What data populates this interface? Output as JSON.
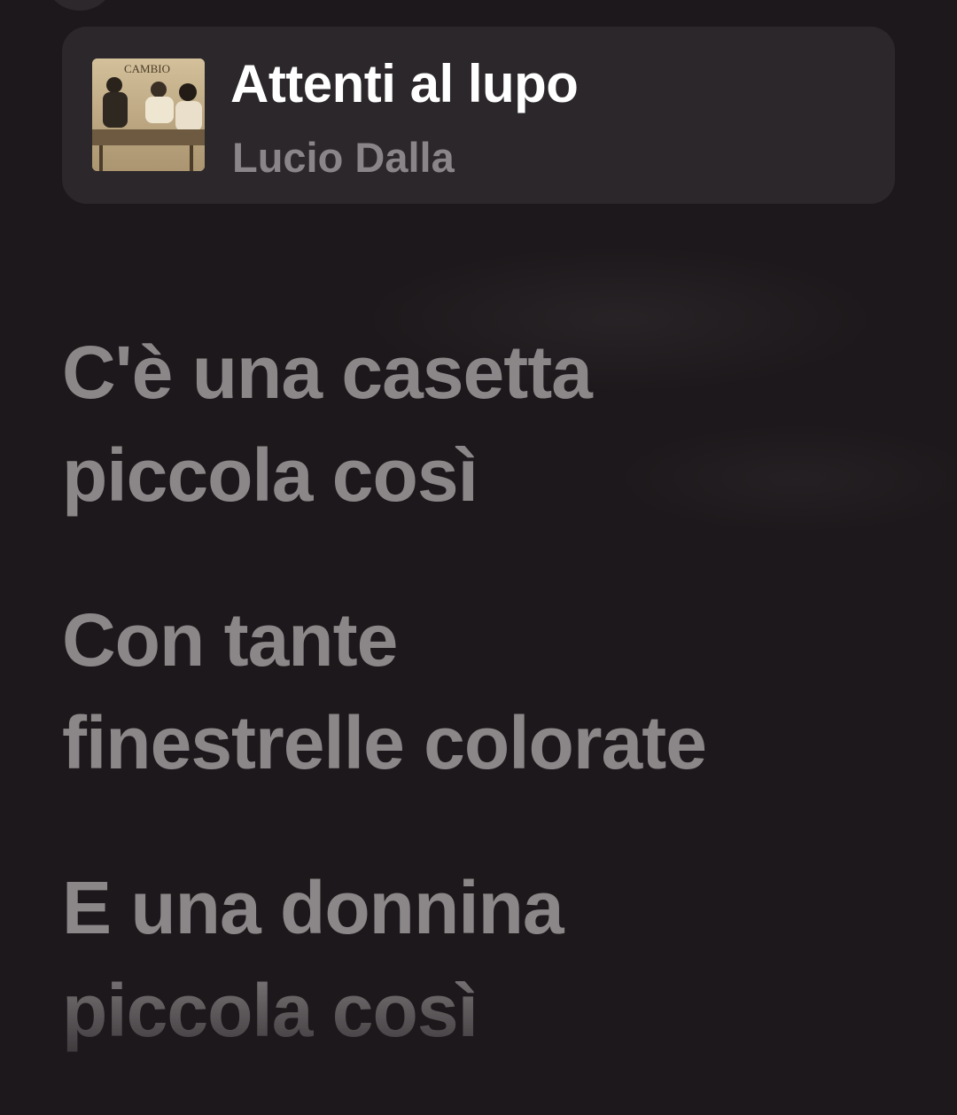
{
  "now_playing": {
    "title": "Attenti al lupo",
    "artist": "Lucio Dalla",
    "artwork_text": "CAMBIO"
  },
  "lyrics": {
    "lines": [
      "C'è una casetta\npiccola così",
      "Con tante\nfinestrelle colorate",
      "E una donnina\npiccola così"
    ]
  },
  "colors": {
    "background": "#1c181b",
    "card": "#2b272a",
    "title": "#ffffff",
    "artist": "#8a8589",
    "lyric": "#8b8789"
  }
}
